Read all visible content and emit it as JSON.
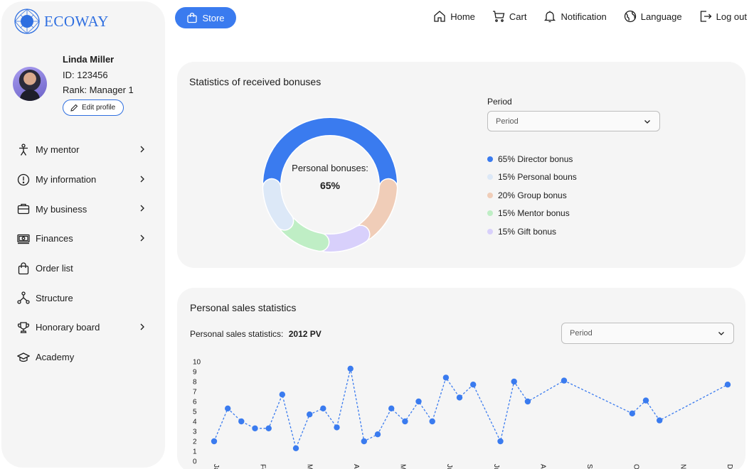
{
  "brand": {
    "name": "ECOWAY"
  },
  "profile": {
    "name": "Linda Miller",
    "id_label": "ID:",
    "id_value": "123456",
    "rank_label": "Rank:",
    "rank_value": "Manager 1",
    "edit_label": "Edit profile"
  },
  "sidebar": {
    "items": [
      {
        "label": "My mentor",
        "icon": "person-icon",
        "has_chevron": true
      },
      {
        "label": "My information",
        "icon": "info-icon",
        "has_chevron": true
      },
      {
        "label": "My business",
        "icon": "briefcase-icon",
        "has_chevron": true
      },
      {
        "label": "Finances",
        "icon": "money-icon",
        "has_chevron": true
      },
      {
        "label": "Order list",
        "icon": "bag-icon",
        "has_chevron": false
      },
      {
        "label": "Structure",
        "icon": "structure-icon",
        "has_chevron": false
      },
      {
        "label": "Honorary board",
        "icon": "trophy-icon",
        "has_chevron": true
      },
      {
        "label": "Academy",
        "icon": "graduation-cap-icon",
        "has_chevron": false
      }
    ]
  },
  "topbar": {
    "store_label": "Store",
    "nav": [
      {
        "label": "Home",
        "icon": "home-icon"
      },
      {
        "label": "Cart",
        "icon": "cart-icon"
      },
      {
        "label": "Notification",
        "icon": "bell-icon"
      },
      {
        "label": "Language",
        "icon": "globe-icon"
      },
      {
        "label": "Log out",
        "icon": "logout-icon"
      }
    ]
  },
  "bonuses": {
    "title": "Statistics of received bonuses",
    "center_label": "Personal bonuses:",
    "center_value": "65%",
    "period_label": "Period",
    "period_placeholder": "Period",
    "legend": [
      {
        "label": "65% Director bonus",
        "color": "#3a7bef"
      },
      {
        "label": "15% Personal bouns",
        "color": "#dce8f7"
      },
      {
        "label": "20% Group bonus",
        "color": "#f0cdb8"
      },
      {
        "label": "15% Mentor bonus",
        "color": "#bfeec5"
      },
      {
        "label": "15% Gift bonus",
        "color": "#d8d0fb"
      }
    ]
  },
  "sales": {
    "title": "Personal sales statistics",
    "summary_label": "Personal sales statistics:",
    "summary_value": "2012 PV",
    "period_placeholder": "Period"
  },
  "chart_data": [
    {
      "type": "pie",
      "title": "Statistics of received bonuses",
      "slices": [
        {
          "label": "Director bonus",
          "value": 65,
          "color": "#3a7bef"
        },
        {
          "label": "Personal bouns",
          "value": 15,
          "color": "#dce8f7"
        },
        {
          "label": "Group bonus",
          "value": 20,
          "color": "#f0cdb8"
        },
        {
          "label": "Mentor bonus",
          "value": 15,
          "color": "#bfeec5"
        },
        {
          "label": "Gift bonus",
          "value": 15,
          "color": "#d8d0fb"
        }
      ]
    },
    {
      "type": "line",
      "title": "Personal sales statistics",
      "ylim": [
        0,
        10
      ],
      "yticks": [
        0,
        1,
        2,
        3,
        4,
        5,
        6,
        7,
        8,
        9,
        10
      ],
      "xticks": [
        "Jan",
        "Feb",
        "Mar",
        "Apr",
        "May",
        "Jun",
        "Jul",
        "Aug",
        "Sep",
        "Oct",
        "Nov",
        "Dec"
      ],
      "xrange": [
        0,
        11.3
      ],
      "x": [
        0,
        0.3,
        0.6,
        0.9,
        1.2,
        1.5,
        1.8,
        2.1,
        2.4,
        2.7,
        3.0,
        3.3,
        3.6,
        3.9,
        4.2,
        4.5,
        4.8,
        5.1,
        5.4,
        5.7,
        6.3,
        6.6,
        6.9,
        7.7,
        9.2,
        9.5,
        9.8,
        11.3
      ],
      "y": [
        2,
        5.3,
        4,
        3.3,
        3.3,
        6.7,
        1.3,
        4.7,
        5.3,
        3.4,
        9.3,
        2,
        2.7,
        5.3,
        4,
        6,
        4,
        8.4,
        6.4,
        7.7,
        2,
        8,
        6,
        8.1,
        4.8,
        6.1,
        4.1,
        7.7
      ],
      "color": "#3a7bef",
      "line_style": "dashed"
    }
  ]
}
